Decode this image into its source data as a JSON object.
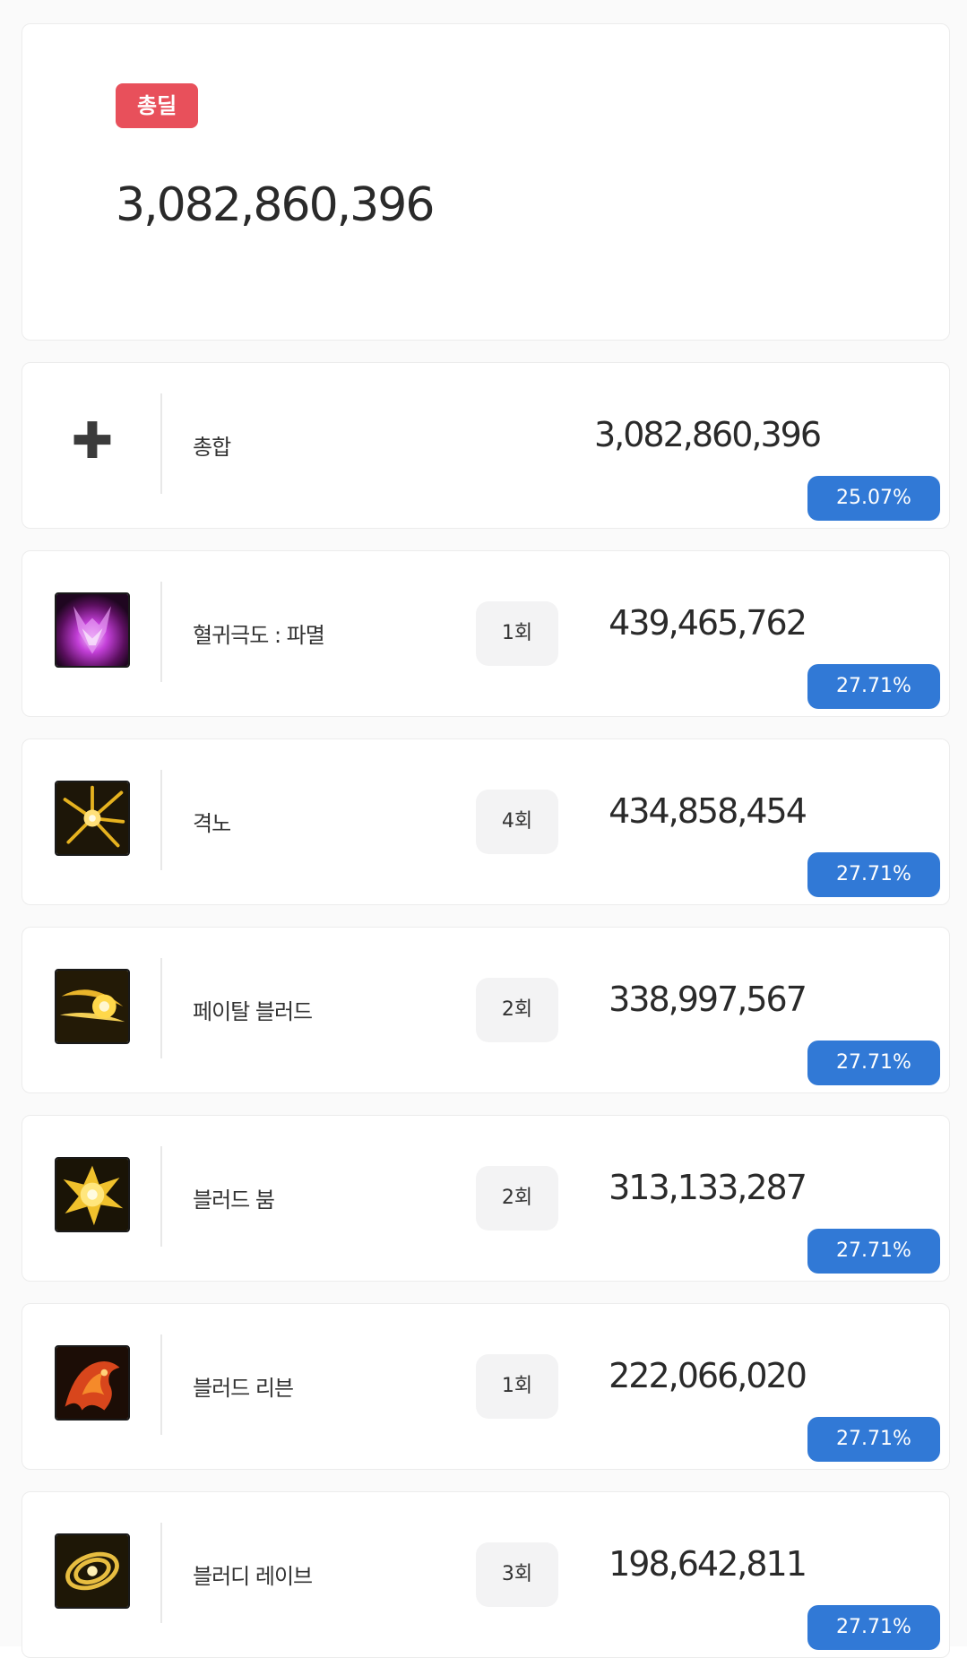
{
  "summary": {
    "badge": "총딜",
    "total": "3,082,860,396"
  },
  "total_row": {
    "icon": "plus-icon",
    "name": "총합",
    "damage": "3,082,860,396",
    "percent": "25.07%"
  },
  "skills": [
    {
      "icon": "skill-icon-crimson-dragon",
      "name": "혈귀극도 : 파멸",
      "count": "1회",
      "damage": "439,465,762",
      "percent": "27.71%"
    },
    {
      "icon": "skill-icon-lightning-burst",
      "name": "격노",
      "count": "4회",
      "damage": "434,858,454",
      "percent": "27.71%"
    },
    {
      "icon": "skill-icon-golden-slash",
      "name": "페이탈 블러드",
      "count": "2회",
      "damage": "338,997,567",
      "percent": "27.71%"
    },
    {
      "icon": "skill-icon-golden-explosion",
      "name": "블러드 붐",
      "count": "2회",
      "damage": "313,133,287",
      "percent": "27.71%"
    },
    {
      "icon": "skill-icon-fire-beast",
      "name": "블러드 리븐",
      "count": "1회",
      "damage": "222,066,020",
      "percent": "27.71%"
    },
    {
      "icon": "skill-icon-golden-spiral",
      "name": "블러디 레이브",
      "count": "3회",
      "damage": "198,642,811",
      "percent": "27.71%"
    }
  ],
  "colors": {
    "total_badge": "#e8505b",
    "percent_badge": "#3179d6"
  }
}
